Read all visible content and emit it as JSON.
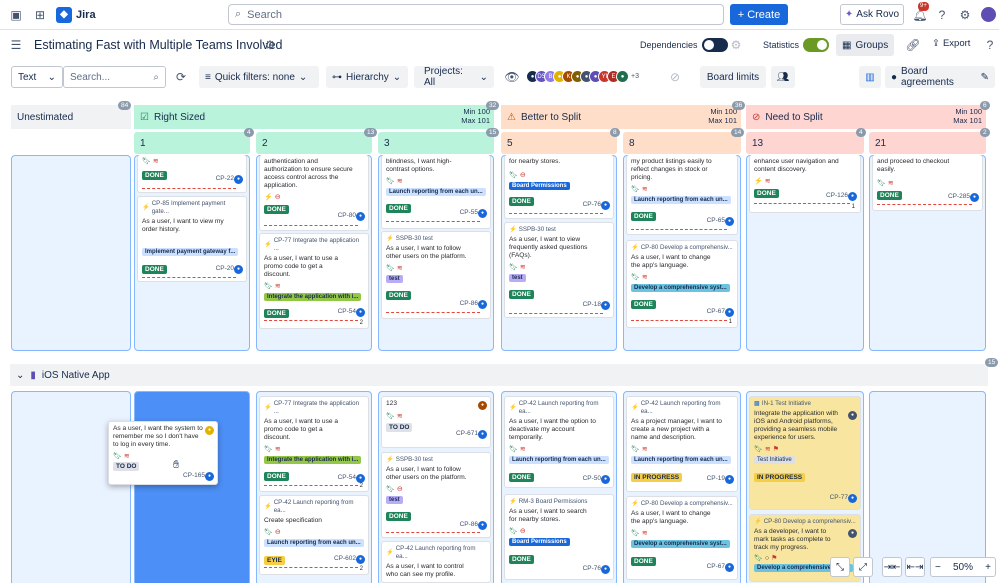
{
  "nav": {
    "app": "Jira",
    "search_placeholder": "Search",
    "create": "Create",
    "rovo": "Ask Rovo",
    "notif_badge": "9+"
  },
  "header": {
    "title": "Estimating Fast with Multiple Teams Involved",
    "dependencies": "Dependencies",
    "statistics": "Statistics",
    "groups": "Groups",
    "export": "Export"
  },
  "toolbar": {
    "text_select": "Text",
    "search_placeholder": "Search...",
    "quick_filters": "Quick filters: none",
    "hierarchy": "Hierarchy",
    "projects": "Projects: All",
    "avatar_more": "+3",
    "board_limits": "Board limits",
    "board_agreements": "Board agreements"
  },
  "columns": {
    "unestimated": {
      "label": "Unestimated",
      "count": "84"
    },
    "right_sized": {
      "label": "Right Sized",
      "count": "32",
      "min": "Min 100",
      "max": "Max 101"
    },
    "better_to_split": {
      "label": "Better to Split",
      "count": "36",
      "min": "Min 100",
      "max": "Max 101"
    },
    "need_to_split": {
      "label": "Need to Split",
      "count": "6",
      "min": "Min 100",
      "max": "Max 101"
    }
  },
  "subcols": [
    {
      "label": "1",
      "count": "4"
    },
    {
      "label": "2",
      "count": "13"
    },
    {
      "label": "3",
      "count": "15"
    },
    {
      "label": "5",
      "count": "8"
    },
    {
      "label": "8",
      "count": "14"
    },
    {
      "label": "13",
      "count": "4"
    },
    {
      "label": "21",
      "count": "2"
    }
  ],
  "swimlane": {
    "label": "iOS Native App",
    "count": "15"
  },
  "zoom": {
    "value": "50%"
  },
  "cards": {
    "c1": {
      "epic": "CP-85 Implement payment gate...",
      "text": "As a user, I want to view my order history.",
      "chip": "Implement payment gateway f...",
      "status": "DONE",
      "key": "CP-20"
    },
    "c1top": {
      "status": "DONE",
      "key": "CP-22"
    },
    "c2top": {
      "text": "authentication and authorization to ensure secure access control across the application.",
      "status": "DONE",
      "key": "CP-80"
    },
    "c2": {
      "epic": "CP-77 Integrate the application ...",
      "text": "As a user, I want to use a promo code to get a discount.",
      "chip": "Integrate the application with i...",
      "status": "DONE",
      "key": "CP-54",
      "count": "2"
    },
    "c3top": {
      "text": "blindness, I want high-contrast options.",
      "chip": "Launch reporting from each un...",
      "status": "DONE",
      "key": "CP-55"
    },
    "c3": {
      "epic": "SSPB-30 test",
      "text": "As a user, I want to follow other users on the platform.",
      "chip": "test",
      "status": "DONE",
      "key": "CP-86"
    },
    "c5top": {
      "text": "for nearby stores.",
      "chip": "Board Permissions",
      "status": "DONE",
      "key": "CP-76"
    },
    "c5": {
      "epic": "SSPB-30 test",
      "text": "As a user, I want to view frequently asked questions (FAQs).",
      "chip": "test",
      "status": "DONE",
      "key": "CP-18"
    },
    "c8top": {
      "text": "my product listings easily to reflect changes in stock or pricing.",
      "chip": "Launch reporting from each un...",
      "status": "DONE",
      "key": "CP-65"
    },
    "c8": {
      "epic": "CP-80 Develop a comprehensiv...",
      "text": "As a user, I want to change the app's language.",
      "chip": "Develop a comprehensive syst...",
      "status": "DONE",
      "key": "CP-67",
      "count": "1"
    },
    "c13top": {
      "text": "enhance user navigation and content discovery.",
      "status": "DONE",
      "key": "CP-126",
      "count": "1"
    },
    "c21top": {
      "text": "and proceed to checkout easily.",
      "status": "DONE",
      "key": "CP-285"
    },
    "drag": {
      "text": "As a user, I want the system to remember me so I don't have to log in every time.",
      "status": "TO DO",
      "key": "CP-165"
    },
    "i2a": {
      "epic": "CP-77 Integrate the application ...",
      "text": "As a user, I want to use a promo code to get a discount.",
      "chip": "Integrate the application with i...",
      "status": "DONE",
      "key": "CP-54",
      "count": "2"
    },
    "i2b": {
      "epic": "CP-42 Launch reporting from ea...",
      "text": "Create specification",
      "chip": "Launch reporting from each un...",
      "status": "EYIE",
      "key": "CP-602",
      "count": "2"
    },
    "i3a": {
      "text": "123",
      "status": "TO DO",
      "key": "CP-671"
    },
    "i3b": {
      "epic": "SSPB-30 test",
      "text": "As a user, I want to follow other users on the platform.",
      "chip": "test",
      "status": "DONE",
      "key": "CP-86"
    },
    "i3c": {
      "epic": "CP-42 Launch reporting from ea...",
      "text": "As a user, I want to control who can see my profile."
    },
    "i5a": {
      "epic": "CP-42 Launch reporting from ea...",
      "text": "As a user, I want the option to deactivate my account temporarily.",
      "chip": "Launch reporting from each un...",
      "status": "DONE",
      "key": "CP-50"
    },
    "i5b": {
      "epic": "RM-3 Board Permissions",
      "text": "As a user, I want to search for nearby stores.",
      "chip": "Board Permissions",
      "status": "DONE",
      "key": "CP-76"
    },
    "i8a": {
      "epic": "CP-42 Launch reporting from ea...",
      "text": "As a project manager, I want to create a new project with a name and description.",
      "chip": "Launch reporting from each un...",
      "status": "IN PROGRESS",
      "key": "CP-19"
    },
    "i8b": {
      "epic": "CP-80 Develop a comprehensiv...",
      "text": "As a user, I want to change the app's language.",
      "chip": "Develop a comprehensive syst...",
      "status": "DONE",
      "key": "CP-67"
    },
    "i13a": {
      "epic": "IN-1 Test Initiative",
      "text": "Integrate the application with iOS and Android platforms, providing a seamless mobile experience for users.",
      "chip": "Test Initiative",
      "status": "IN PROGRESS",
      "key": "CP-77"
    },
    "i13b": {
      "epic": "CP-80 Develop a comprehensiv...",
      "text": "As a developer, I want to mark tasks as complete to track my progress.",
      "chip": "Develop a comprehensive syst..."
    }
  },
  "colors": {
    "done": "#1f845a",
    "blue_col": "#e9f2ff",
    "green": "#baf3db",
    "orange": "#fedec8",
    "red": "#ffd5d2"
  }
}
